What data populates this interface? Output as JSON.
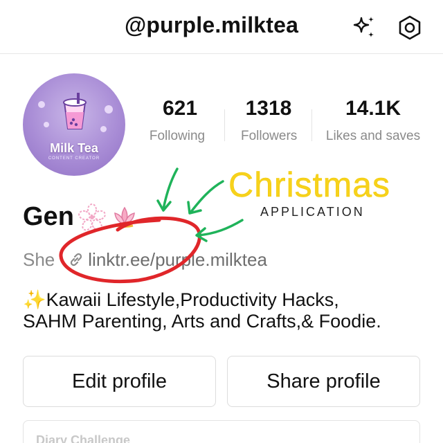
{
  "header": {
    "handle": "@purple.milktea",
    "icons": [
      "sparkle-icon",
      "settings-icon"
    ]
  },
  "avatar": {
    "title": "Milk Tea",
    "subtitle": "CONTENT CREATOR"
  },
  "stats": [
    {
      "value": "621",
      "label": "Following"
    },
    {
      "value": "1318",
      "label": "Followers"
    },
    {
      "value": "14.1K",
      "label": "Likes and saves"
    }
  ],
  "profile": {
    "name": "Gen",
    "pronoun": "She",
    "link": "linktr.ee/purple.milktea",
    "bio_line1": "✨Kawaii Lifestyle,Productivity Hacks,",
    "bio_line2": "SAHM Parenting, Arts and Crafts,& Foodie."
  },
  "actions": {
    "edit_label": "Edit profile",
    "share_label": "Share profile"
  },
  "card_peek": {
    "text": "Diary Challenge"
  },
  "annotation": {
    "headline": "Christmas",
    "subline": "APPLICATION",
    "circle_color": "#e0262a",
    "arrow_color": "#1fb35a",
    "headline_color": "#f7d21c"
  }
}
